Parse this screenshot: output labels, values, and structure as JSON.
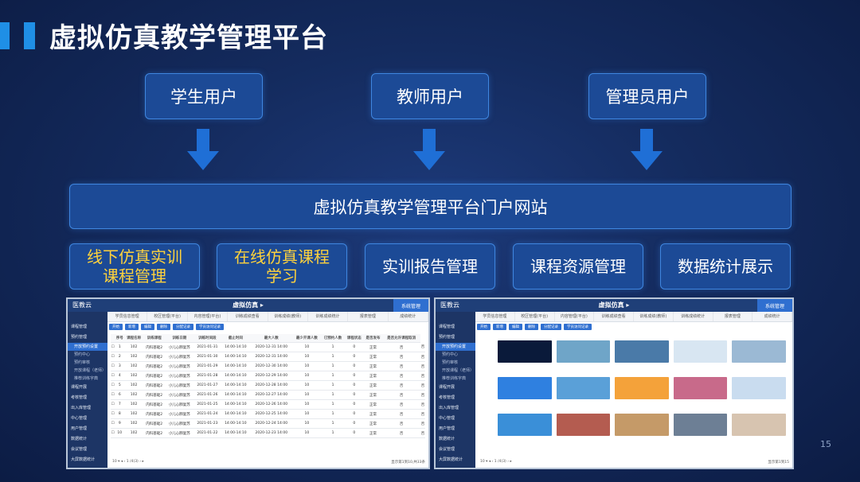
{
  "page": {
    "title": "虚拟仿真教学管理平台",
    "page_number": "15",
    "colors": {
      "accent": "#1f8fe6",
      "box_fill": "#1c4a96",
      "box_border": "#3f86e0",
      "highlight_text": "#ffd23c"
    }
  },
  "users": [
    {
      "label": "学生用户"
    },
    {
      "label": "教师用户"
    },
    {
      "label": "管理员用户"
    }
  ],
  "portal": {
    "label": "虚拟仿真教学管理平台门户网站"
  },
  "modules": [
    {
      "label": "线下仿真实训课程管理",
      "line1": "线下仿真实训",
      "line2": "课程管理",
      "highlighted": true
    },
    {
      "label": "在线仿真课程学习",
      "line1": "在线仿真课程",
      "line2": "学习",
      "highlighted": true
    },
    {
      "label": "实训报告管理",
      "highlighted": false
    },
    {
      "label": "课程资源管理",
      "highlighted": false
    },
    {
      "label": "数据统计展示",
      "highlighted": false
    }
  ],
  "screenshots": {
    "left": {
      "logo": "医教云",
      "header": "虚拟仿真 ▸",
      "right_button": "系统管理",
      "tabs": [
        "学员信息管理",
        "校区管理(平台)",
        "内容管理(平台)",
        "训练成绩查看",
        "训练成绩(教师)",
        "训练成绩统计",
        "报表管理",
        "成绩统计"
      ],
      "side": [
        {
          "label": "课程管理",
          "type": "main"
        },
        {
          "label": "预约管理",
          "type": "main"
        },
        {
          "label": "开放预约设置",
          "type": "sub",
          "active": true
        },
        {
          "label": "预约中心",
          "type": "sub"
        },
        {
          "label": "预约审核",
          "type": "sub"
        },
        {
          "label": "开放课程（老师）",
          "type": "sub"
        },
        {
          "label": "推荐训练字典",
          "type": "sub"
        },
        {
          "label": "课程开展",
          "type": "main"
        },
        {
          "label": "考核管理",
          "type": "main"
        },
        {
          "label": "出入库管理",
          "type": "main"
        },
        {
          "label": "中心管理",
          "type": "main"
        },
        {
          "label": "用户管理",
          "type": "main"
        },
        {
          "label": "数据统计",
          "type": "main"
        },
        {
          "label": "会议管理",
          "type": "main"
        },
        {
          "label": "大屏数据统计",
          "type": "main"
        }
      ],
      "toolbar": [
        "开始",
        "新增",
        "编辑",
        "删除",
        "分配记录",
        "学员访问记录"
      ],
      "columns": [
        "",
        "序号",
        "课程名称",
        "训练课程",
        "训练日期",
        "训练时间段",
        "截止时间",
        "最大人数",
        "最少开课人数",
        "已预约人数",
        "课程状态",
        "是否发布",
        "是否允许课程取消"
      ],
      "rows": [
        [
          "1",
          "102",
          "内科基础2",
          "小儿心肺复苏",
          "2021-01-31",
          "14:00-14:10",
          "2020-12-31 14:00",
          "10",
          "1",
          "0",
          "正常",
          "否",
          "否"
        ],
        [
          "2",
          "102",
          "内科基础2",
          "小儿心肺复苏",
          "2021-01-30",
          "14:00-14:10",
          "2020-12-31 14:00",
          "10",
          "1",
          "0",
          "正常",
          "否",
          "否"
        ],
        [
          "3",
          "102",
          "内科基础2",
          "小儿心肺复苏",
          "2021-01-29",
          "14:00-14:10",
          "2020-12-30 14:00",
          "10",
          "1",
          "0",
          "正常",
          "否",
          "否"
        ],
        [
          "4",
          "102",
          "内科基础2",
          "小儿心肺复苏",
          "2021-01-28",
          "14:00-14:10",
          "2020-12-29 14:00",
          "10",
          "1",
          "0",
          "正常",
          "否",
          "否"
        ],
        [
          "5",
          "102",
          "内科基础2",
          "小儿心肺复苏",
          "2021-01-27",
          "14:00-14:10",
          "2020-12-28 14:00",
          "10",
          "1",
          "0",
          "正常",
          "否",
          "否"
        ],
        [
          "6",
          "102",
          "内科基础2",
          "小儿心肺复苏",
          "2021-01-26",
          "14:00-14:10",
          "2020-12-27 14:00",
          "10",
          "1",
          "0",
          "正常",
          "否",
          "否"
        ],
        [
          "7",
          "102",
          "内科基础2",
          "小儿心肺复苏",
          "2021-01-25",
          "14:00-14:10",
          "2020-12-26 14:00",
          "10",
          "1",
          "0",
          "正常",
          "否",
          "否"
        ],
        [
          "8",
          "102",
          "内科基础2",
          "小儿心肺复苏",
          "2021-01-24",
          "14:00-14:10",
          "2020-12-25 14:00",
          "10",
          "1",
          "0",
          "正常",
          "否",
          "否"
        ],
        [
          "9",
          "102",
          "内科基础2",
          "小儿心肺复苏",
          "2021-01-23",
          "14:00-14:10",
          "2020-12-24 14:00",
          "10",
          "1",
          "0",
          "正常",
          "否",
          "否"
        ],
        [
          "10",
          "102",
          "内科基础2",
          "小儿心肺复苏",
          "2021-01-22",
          "14:00-14:10",
          "2020-12-23 14:00",
          "10",
          "1",
          "0",
          "正常",
          "否",
          "否"
        ]
      ],
      "pager_left": "10 ▾   ◂   ‹   1  /4(3)   ›   ▸",
      "pager_right": "显示第1到10,共33条"
    },
    "right": {
      "logo": "医教云",
      "header": "虚拟仿真 ▸",
      "right_button": "系统管理",
      "tabs": [
        "学员信息管理",
        "校区管理(平台)",
        "内容管理(平台)",
        "训练成绩查看",
        "训练成绩(教师)",
        "训练成绩统计",
        "报表管理",
        "成绩统计"
      ],
      "side": [
        {
          "label": "课程管理",
          "type": "main"
        },
        {
          "label": "预约管理",
          "type": "main"
        },
        {
          "label": "开放预约设置",
          "type": "sub",
          "active": true
        },
        {
          "label": "预约中心",
          "type": "sub"
        },
        {
          "label": "预约审核",
          "type": "sub"
        },
        {
          "label": "开放课程（老师）",
          "type": "sub"
        },
        {
          "label": "推荐训练字典",
          "type": "sub"
        },
        {
          "label": "课程开展",
          "type": "main"
        },
        {
          "label": "考核管理",
          "type": "main"
        },
        {
          "label": "出入库管理",
          "type": "main"
        },
        {
          "label": "中心管理",
          "type": "main"
        },
        {
          "label": "用户管理",
          "type": "main"
        },
        {
          "label": "数据统计",
          "type": "main"
        },
        {
          "label": "会议管理",
          "type": "main"
        },
        {
          "label": "大屏数据统计",
          "type": "main"
        }
      ],
      "toolbar": [
        "开始",
        "新增",
        "编辑",
        "删除",
        "分配记录",
        "学员访问记录"
      ],
      "cards": [
        {
          "color": "#0a1a3a"
        },
        {
          "color": "#6fa5c8"
        },
        {
          "color": "#4a7aa8"
        },
        {
          "color": "#d8e6f2"
        },
        {
          "color": "#9bb9d4"
        },
        {
          "color": "#2f80e0"
        },
        {
          "color": "#5aa0d8"
        },
        {
          "color": "#f4a23a"
        },
        {
          "color": "#c86a8a"
        },
        {
          "color": "#c9dcef"
        },
        {
          "color": "#3a8fd8"
        },
        {
          "color": "#b45c50"
        },
        {
          "color": "#c59a68"
        },
        {
          "color": "#6d7f95"
        },
        {
          "color": "#d7c4b0"
        }
      ],
      "pager_left": "10 ▾   ◂   ‹   1  /4(3)   ›   ▸",
      "pager_right": "显示第1到15"
    }
  }
}
